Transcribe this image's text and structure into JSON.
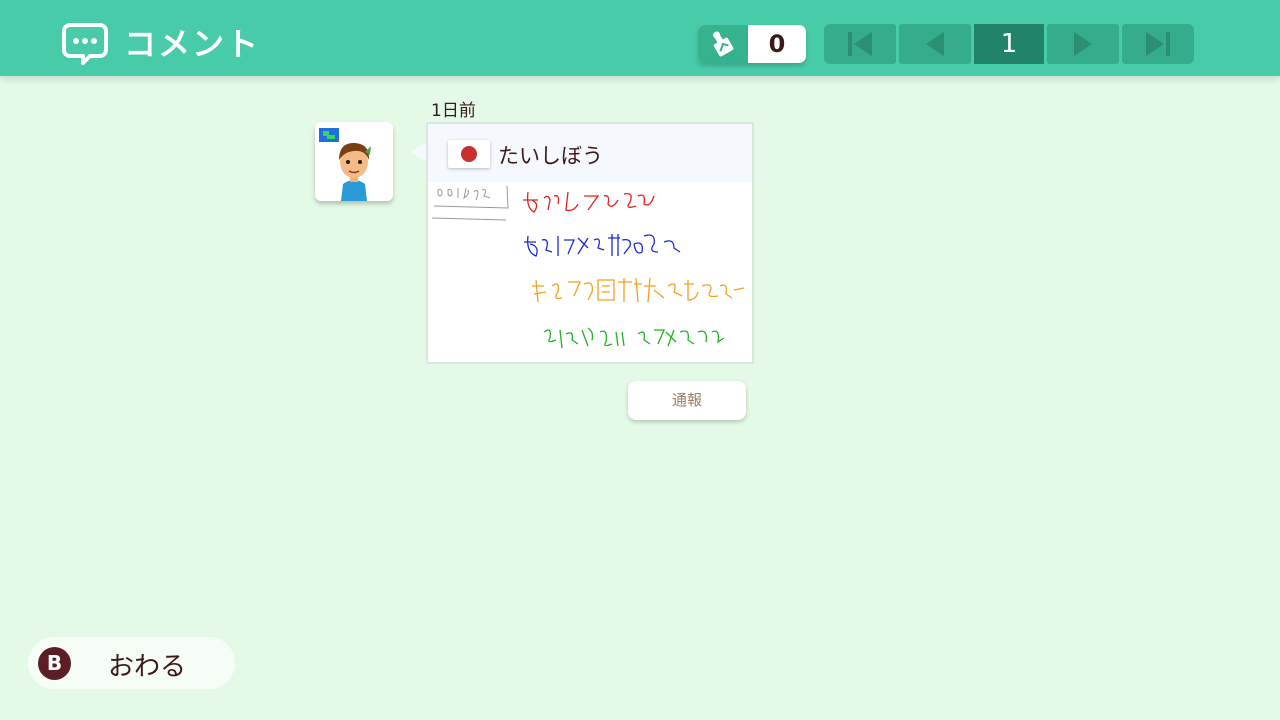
{
  "header": {
    "title": "コメント",
    "stamp_count": "0",
    "current_page": "1"
  },
  "comment": {
    "time_ago": "1日前",
    "user_name": "たいしぼう",
    "flag": "japan-flag"
  },
  "report_button": "通報",
  "footer": {
    "button_glyph": "B",
    "end_label": "おわる"
  },
  "colors": {
    "header_bg": "#48cba8",
    "page_bg": "#e4f9e6",
    "pager_bg": "#35ac8b",
    "pager_active": "#20836a",
    "text_dark": "#3d1a1a"
  }
}
